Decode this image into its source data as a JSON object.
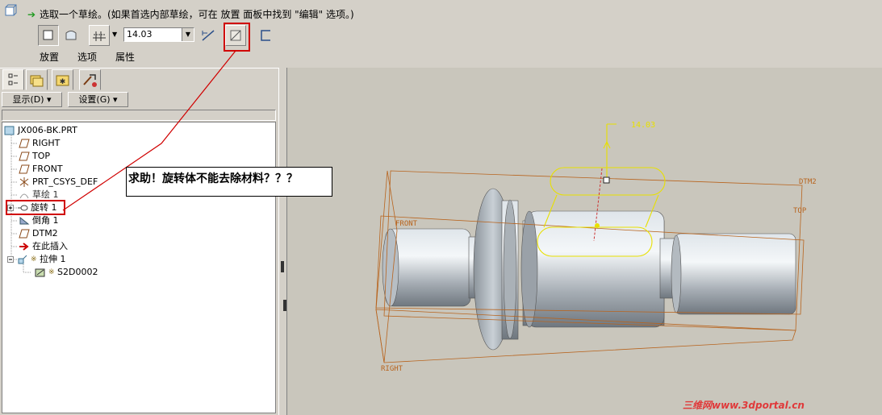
{
  "prompt": {
    "text": "选取一个草绘。(如果首选内部草绘，可在 放置 面板中找到 \"编辑\" 选项。)"
  },
  "dashboard": {
    "depth_value": "14.03",
    "tabs": [
      {
        "label": "放置"
      },
      {
        "label": "选项"
      },
      {
        "label": "属性"
      }
    ]
  },
  "panel": {
    "show_menu": "显示(D) ▾",
    "settings_menu": "设置(G) ▾",
    "tree": [
      {
        "label": "JX006-BK.PRT",
        "icon": "part-icon"
      },
      {
        "label": "RIGHT",
        "icon": "datum-plane-icon"
      },
      {
        "label": "TOP",
        "icon": "datum-plane-icon"
      },
      {
        "label": "FRONT",
        "icon": "datum-plane-icon"
      },
      {
        "label": "PRT_CSYS_DEF",
        "icon": "csys-icon"
      },
      {
        "label": "草绘 1",
        "icon": "sketch-icon"
      },
      {
        "label": "旋转 1",
        "icon": "revolve-icon"
      },
      {
        "label": "倒角 1",
        "icon": "chamfer-icon"
      },
      {
        "label": "DTM2",
        "icon": "datum-plane-icon"
      },
      {
        "label": "在此插入",
        "icon": "insert-arrow-icon"
      },
      {
        "label": "拉伸 1",
        "icon": "extrude-icon"
      },
      {
        "label": "S2D0002",
        "icon": "section-icon"
      }
    ]
  },
  "callout": {
    "text": "求助！旋转体不能去除材料？？？"
  },
  "viewport": {
    "dimension_label": "14.03",
    "labels": {
      "dtm2": "DTM2",
      "top": "TOP",
      "front": "FRONT",
      "right": "RIGHT"
    }
  },
  "watermark": {
    "text": "三维网www.3dportal.cn"
  },
  "colors": {
    "highlight_red": "#d00000",
    "sketch_yellow": "#e8e000",
    "datum_orange": "#b8641e",
    "viewport_bg": "#c9c6bc"
  }
}
